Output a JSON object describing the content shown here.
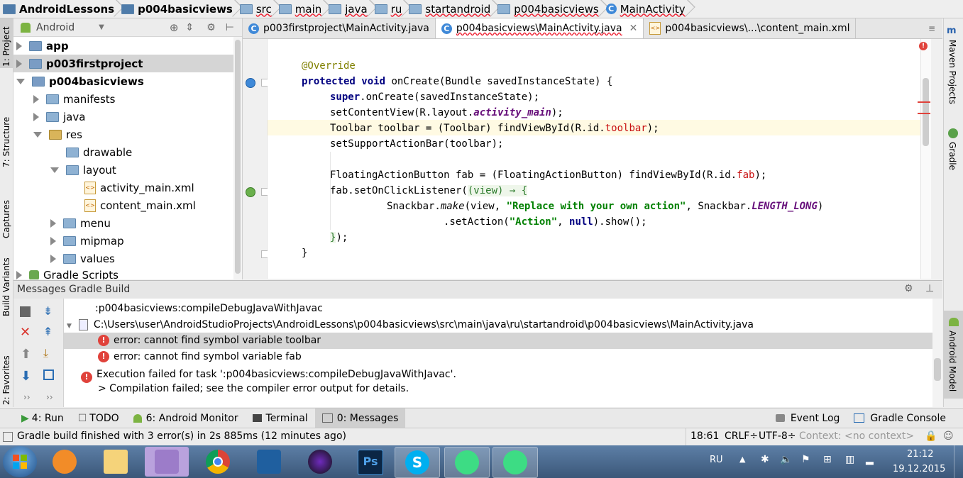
{
  "breadcrumb": [
    "AndroidLessons",
    "p004basicviews",
    "src",
    "main",
    "java",
    "ru",
    "startandroid",
    "p004basicviews",
    "MainActivity"
  ],
  "left_strip": {
    "project": "1: Project",
    "structure": "7: Structure",
    "captures": "Captures",
    "build_variants": "Build Variants",
    "favorites": "2: Favorites"
  },
  "right_strip": {
    "maven": "Maven Projects",
    "gradle": "Gradle",
    "android_model": "Android Model"
  },
  "project_pane": {
    "view_selector": "Android",
    "tree": [
      {
        "label": "app",
        "bold": true
      },
      {
        "label": "p003firstproject",
        "bold": true
      },
      {
        "label": "p004basicviews",
        "bold": true
      },
      {
        "label": "manifests"
      },
      {
        "label": "java"
      },
      {
        "label": "res"
      },
      {
        "label": "drawable"
      },
      {
        "label": "layout"
      },
      {
        "label": "activity_main.xml"
      },
      {
        "label": "content_main.xml"
      },
      {
        "label": "menu"
      },
      {
        "label": "mipmap"
      },
      {
        "label": "values"
      },
      {
        "label": "Gradle Scripts"
      }
    ]
  },
  "editor_tabs": [
    "p003firstproject\\MainActivity.java",
    "p004basicviews\\MainActivity.java",
    "p004basicviews\\...\\content_main.xml"
  ],
  "code": {
    "l1": "@Override",
    "l2_kw1": "protected",
    "l2_kw2": "void",
    "l2_rest": " onCreate(Bundle savedInstanceState) {",
    "l3_kw": "super",
    "l3_rest": ".onCreate(savedInstanceState);",
    "l4_a": "setContentView(R.layout.",
    "l4_f": "activity_main",
    "l4_b": ");",
    "l5_a": "Toolbar toolbar = (Toolbar) findViewById(R.id.",
    "l5_f": "toolbar",
    "l5_b": ");",
    "l6": "setSupportActionBar(toolbar);",
    "l7_a": "FloatingActionButton fab = (FloatingActionButton) findViewById(R.id.",
    "l7_f": "fab",
    "l7_b": ");",
    "l8_a": "fab.setOnClickListener(",
    "l8_lam": "(view) → {",
    "l9_a": "Snackbar.",
    "l9_make": "make",
    "l9_b": "(view, ",
    "l9_s": "\"Replace with your own action\"",
    "l9_c": ", Snackbar.",
    "l9_f": "LENGTH_LONG",
    "l9_d": ")",
    "l10_a": ".setAction(",
    "l10_s": "\"Action\"",
    "l10_b": ", ",
    "l10_n": "null",
    "l10_c": ").show();",
    "l11_a": "}",
    "l11_b": ");",
    "l12": "}"
  },
  "messages": {
    "header": "Messages Gradle Build",
    "task": ":p004basicviews:compileDebugJavaWithJavac",
    "file": "C:\\Users\\user\\AndroidStudioProjects\\AndroidLessons\\p004basicviews\\src\\main\\java\\ru\\startandroid\\p004basicviews\\MainActivity.java",
    "err1": "error: cannot find symbol variable toolbar",
    "err2": "error: cannot find symbol variable fab",
    "exec1": "Execution failed for task ':p004basicviews:compileDebugJavaWithJavac'.",
    "exec2": "> Compilation failed; see the compiler error output for details."
  },
  "bottom_tools": {
    "run": "4: Run",
    "todo": "TODO",
    "monitor": "6: Android Monitor",
    "terminal": "Terminal",
    "messages": "0: Messages",
    "event_log": "Event Log",
    "gradle_console": "Gradle Console"
  },
  "status": {
    "text": "Gradle build finished with 3 error(s) in 2s 885ms (12 minutes ago)",
    "position": "18:61",
    "line_sep": "CRLF÷",
    "encoding": "UTF-8÷",
    "context": "Context: <no context>"
  },
  "taskbar": {
    "lang": "RU",
    "time": "21:12",
    "date": "19.12.2015"
  },
  "colors": {
    "accent": "#3f89d8",
    "error": "#e0423b",
    "selection": "#d5d5d5",
    "caret_line": "#fffae3"
  }
}
